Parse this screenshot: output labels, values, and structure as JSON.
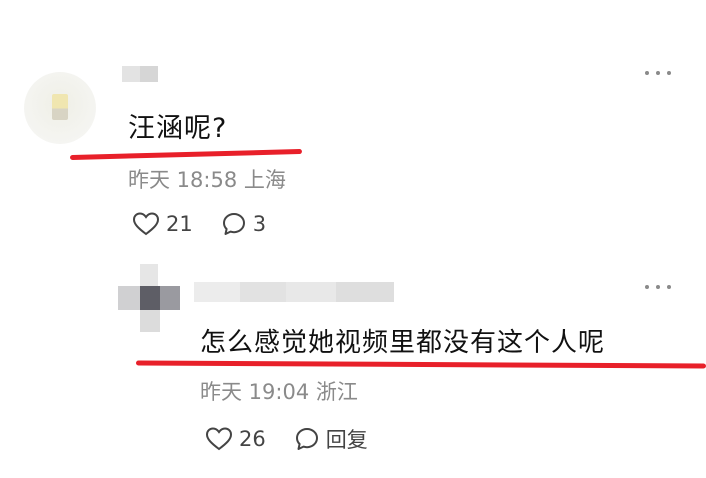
{
  "comments": [
    {
      "text": "汪涵呢?",
      "time": "昨天 18:58",
      "location": "上海",
      "likes": "21",
      "replies": "3",
      "like_icon": "heart-outline-icon",
      "reply_icon": "speech-bubble-icon"
    }
  ],
  "reply": {
    "text": "怎么感觉她视频里都没有这个人呢",
    "time": "昨天 19:04",
    "location": "浙江",
    "likes": "26",
    "reply_label": "回复",
    "like_icon": "heart-outline-icon",
    "reply_icon": "speech-bubble-icon"
  },
  "colors": {
    "highlight": "#e8202a",
    "meta": "#8a8a8a"
  }
}
